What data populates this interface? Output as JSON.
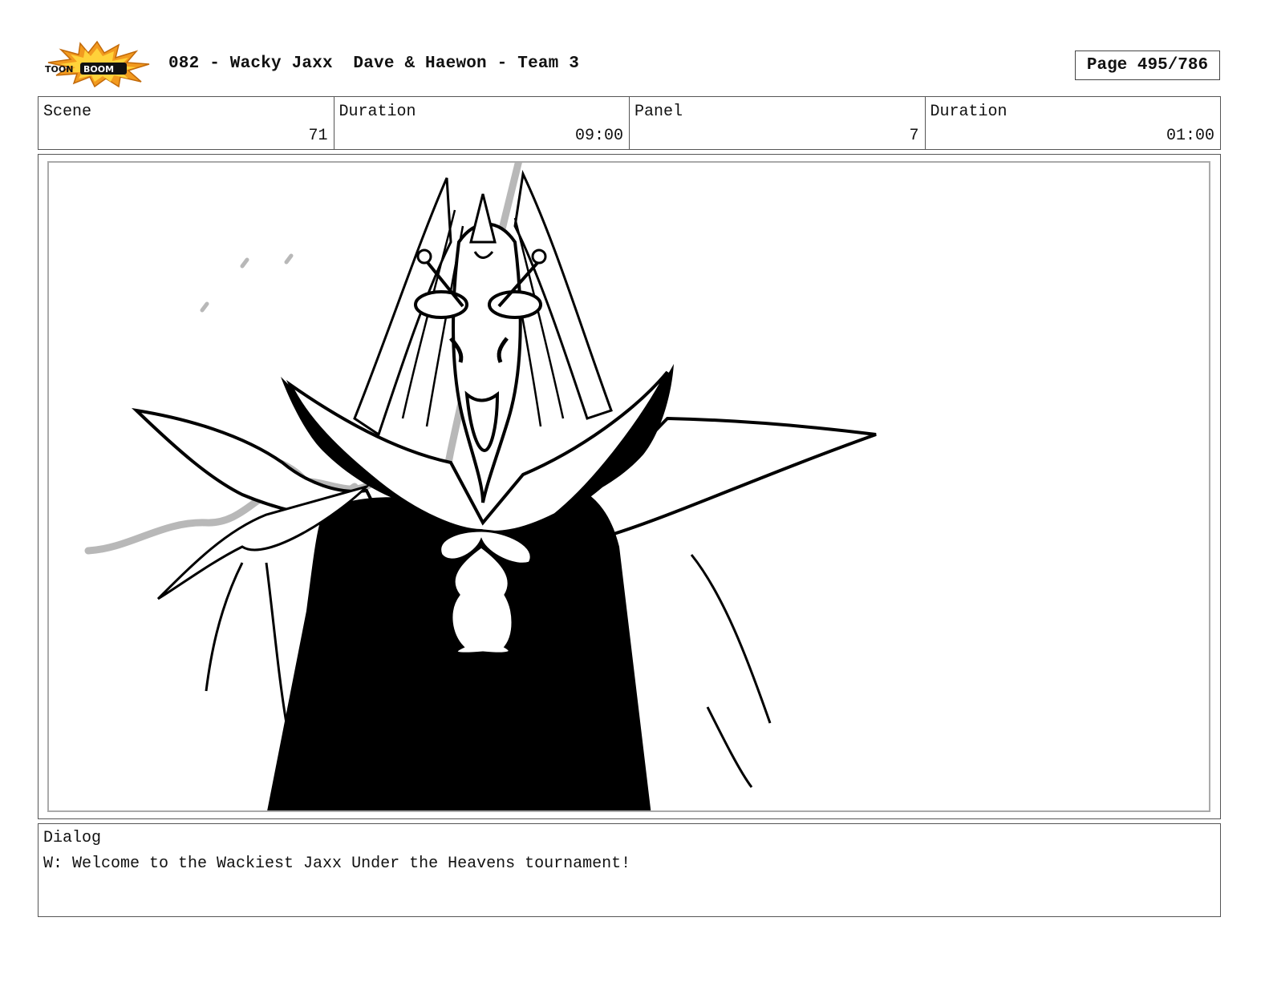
{
  "header": {
    "logo_text": "TOON BOOM",
    "title": "082 - Wacky Jaxx  Dave & Haewon - Team 3",
    "page": "Page 495/786"
  },
  "info": {
    "scene_label": "Scene",
    "scene_value": "71",
    "scene_duration_label": "Duration",
    "scene_duration_value": "09:00",
    "panel_label": "Panel",
    "panel_value": "7",
    "panel_duration_label": "Duration",
    "panel_duration_value": "01:00"
  },
  "panel": {
    "image_icon": "character-sketch",
    "line_color": "#000000",
    "rough_color": "#b8b8b8"
  },
  "dialog": {
    "label": "Dialog",
    "text": "W: Welcome to the Wackiest Jaxx Under the Heavens tournament!"
  }
}
